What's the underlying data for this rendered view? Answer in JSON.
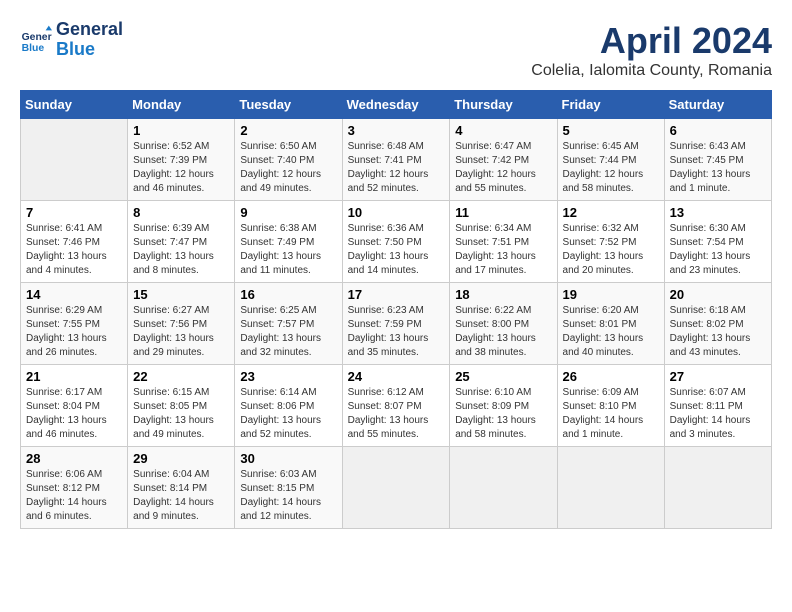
{
  "header": {
    "logo_line1": "General",
    "logo_line2": "Blue",
    "title": "April 2024",
    "subtitle": "Colelia, Ialomita County, Romania"
  },
  "calendar": {
    "days_of_week": [
      "Sunday",
      "Monday",
      "Tuesday",
      "Wednesday",
      "Thursday",
      "Friday",
      "Saturday"
    ],
    "weeks": [
      [
        {
          "num": "",
          "info": ""
        },
        {
          "num": "1",
          "info": "Sunrise: 6:52 AM\nSunset: 7:39 PM\nDaylight: 12 hours\nand 46 minutes."
        },
        {
          "num": "2",
          "info": "Sunrise: 6:50 AM\nSunset: 7:40 PM\nDaylight: 12 hours\nand 49 minutes."
        },
        {
          "num": "3",
          "info": "Sunrise: 6:48 AM\nSunset: 7:41 PM\nDaylight: 12 hours\nand 52 minutes."
        },
        {
          "num": "4",
          "info": "Sunrise: 6:47 AM\nSunset: 7:42 PM\nDaylight: 12 hours\nand 55 minutes."
        },
        {
          "num": "5",
          "info": "Sunrise: 6:45 AM\nSunset: 7:44 PM\nDaylight: 12 hours\nand 58 minutes."
        },
        {
          "num": "6",
          "info": "Sunrise: 6:43 AM\nSunset: 7:45 PM\nDaylight: 13 hours\nand 1 minute."
        }
      ],
      [
        {
          "num": "7",
          "info": "Sunrise: 6:41 AM\nSunset: 7:46 PM\nDaylight: 13 hours\nand 4 minutes."
        },
        {
          "num": "8",
          "info": "Sunrise: 6:39 AM\nSunset: 7:47 PM\nDaylight: 13 hours\nand 8 minutes."
        },
        {
          "num": "9",
          "info": "Sunrise: 6:38 AM\nSunset: 7:49 PM\nDaylight: 13 hours\nand 11 minutes."
        },
        {
          "num": "10",
          "info": "Sunrise: 6:36 AM\nSunset: 7:50 PM\nDaylight: 13 hours\nand 14 minutes."
        },
        {
          "num": "11",
          "info": "Sunrise: 6:34 AM\nSunset: 7:51 PM\nDaylight: 13 hours\nand 17 minutes."
        },
        {
          "num": "12",
          "info": "Sunrise: 6:32 AM\nSunset: 7:52 PM\nDaylight: 13 hours\nand 20 minutes."
        },
        {
          "num": "13",
          "info": "Sunrise: 6:30 AM\nSunset: 7:54 PM\nDaylight: 13 hours\nand 23 minutes."
        }
      ],
      [
        {
          "num": "14",
          "info": "Sunrise: 6:29 AM\nSunset: 7:55 PM\nDaylight: 13 hours\nand 26 minutes."
        },
        {
          "num": "15",
          "info": "Sunrise: 6:27 AM\nSunset: 7:56 PM\nDaylight: 13 hours\nand 29 minutes."
        },
        {
          "num": "16",
          "info": "Sunrise: 6:25 AM\nSunset: 7:57 PM\nDaylight: 13 hours\nand 32 minutes."
        },
        {
          "num": "17",
          "info": "Sunrise: 6:23 AM\nSunset: 7:59 PM\nDaylight: 13 hours\nand 35 minutes."
        },
        {
          "num": "18",
          "info": "Sunrise: 6:22 AM\nSunset: 8:00 PM\nDaylight: 13 hours\nand 38 minutes."
        },
        {
          "num": "19",
          "info": "Sunrise: 6:20 AM\nSunset: 8:01 PM\nDaylight: 13 hours\nand 40 minutes."
        },
        {
          "num": "20",
          "info": "Sunrise: 6:18 AM\nSunset: 8:02 PM\nDaylight: 13 hours\nand 43 minutes."
        }
      ],
      [
        {
          "num": "21",
          "info": "Sunrise: 6:17 AM\nSunset: 8:04 PM\nDaylight: 13 hours\nand 46 minutes."
        },
        {
          "num": "22",
          "info": "Sunrise: 6:15 AM\nSunset: 8:05 PM\nDaylight: 13 hours\nand 49 minutes."
        },
        {
          "num": "23",
          "info": "Sunrise: 6:14 AM\nSunset: 8:06 PM\nDaylight: 13 hours\nand 52 minutes."
        },
        {
          "num": "24",
          "info": "Sunrise: 6:12 AM\nSunset: 8:07 PM\nDaylight: 13 hours\nand 55 minutes."
        },
        {
          "num": "25",
          "info": "Sunrise: 6:10 AM\nSunset: 8:09 PM\nDaylight: 13 hours\nand 58 minutes."
        },
        {
          "num": "26",
          "info": "Sunrise: 6:09 AM\nSunset: 8:10 PM\nDaylight: 14 hours\nand 1 minute."
        },
        {
          "num": "27",
          "info": "Sunrise: 6:07 AM\nSunset: 8:11 PM\nDaylight: 14 hours\nand 3 minutes."
        }
      ],
      [
        {
          "num": "28",
          "info": "Sunrise: 6:06 AM\nSunset: 8:12 PM\nDaylight: 14 hours\nand 6 minutes."
        },
        {
          "num": "29",
          "info": "Sunrise: 6:04 AM\nSunset: 8:14 PM\nDaylight: 14 hours\nand 9 minutes."
        },
        {
          "num": "30",
          "info": "Sunrise: 6:03 AM\nSunset: 8:15 PM\nDaylight: 14 hours\nand 12 minutes."
        },
        {
          "num": "",
          "info": ""
        },
        {
          "num": "",
          "info": ""
        },
        {
          "num": "",
          "info": ""
        },
        {
          "num": "",
          "info": ""
        }
      ]
    ]
  }
}
